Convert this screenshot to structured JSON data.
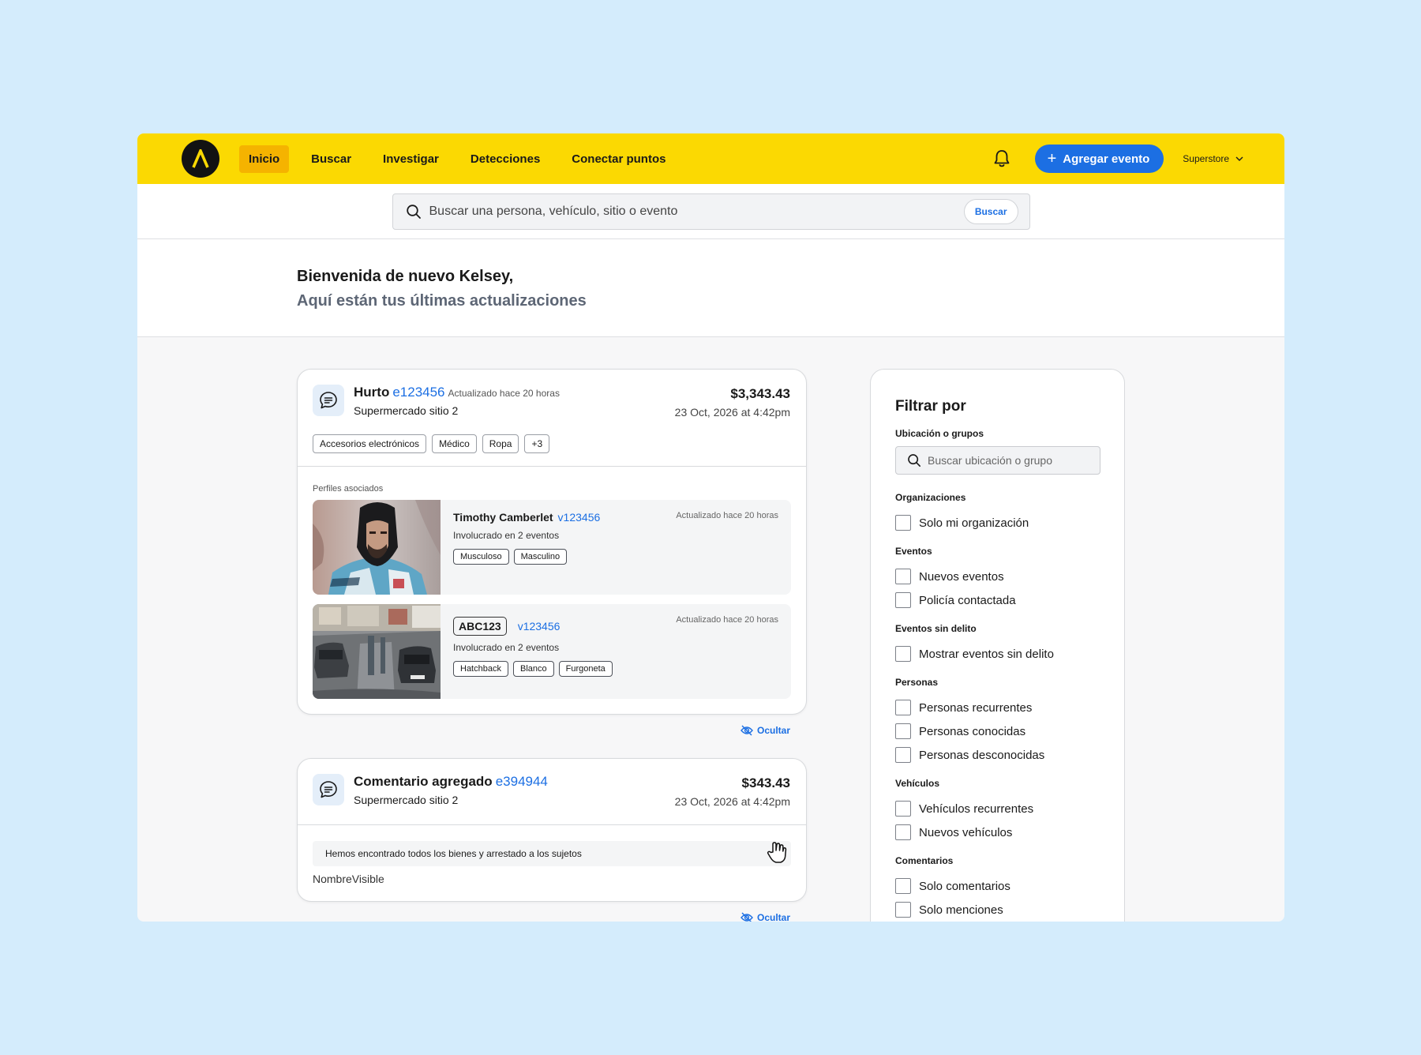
{
  "nav": {
    "items": [
      {
        "label": "Inicio",
        "active": true
      },
      {
        "label": "Buscar",
        "active": false
      },
      {
        "label": "Investigar",
        "active": false
      },
      {
        "label": "Detecciones",
        "active": false
      },
      {
        "label": "Conectar puntos",
        "active": false
      }
    ],
    "add_event_label": "Agregar evento",
    "store_label": "Superstore",
    "icons": {
      "logo": "caret-logo-icon",
      "bell": "bell-icon",
      "add": "plus-icon",
      "store": "chevron-down-icon"
    }
  },
  "search": {
    "placeholder": "Buscar una persona, vehículo, sitio o evento",
    "button_label": "Buscar"
  },
  "welcome": {
    "title": "Bienvenida de nuevo Kelsey,",
    "subtitle": "Aquí están tus últimas actualizaciones"
  },
  "events": [
    {
      "title": "Hurto",
      "id": "e123456",
      "updated": "Actualizado hace 20 horas",
      "site": "Supermercado sitio 2",
      "amount": "$3,343.43",
      "date": "23 Oct, 2026 at 4:42pm",
      "tags": [
        "Accesorios electrónicos",
        "Médico",
        "Ropa",
        "+3"
      ],
      "profiles_label": "Perfiles asociados",
      "profiles": [
        {
          "name": "Timothy Camberlet",
          "id": "v123456",
          "involved": "Involucrado en 2 eventos",
          "updated": "Actualizado hace 20 horas",
          "tags": [
            "Musculoso",
            "Masculino"
          ]
        },
        {
          "plate": "ABC123",
          "id": "v123456",
          "involved": "Involucrado en 2 eventos",
          "updated": "Actualizado hace 20 horas",
          "tags": [
            "Hatchback",
            "Blanco",
            "Furgoneta"
          ]
        }
      ],
      "hide_label": "Ocultar"
    },
    {
      "title": "Comentario agregado",
      "id": "e394944",
      "site": "Supermercado sitio 2",
      "amount": "$343.43",
      "date": "23 Oct, 2026 at 4:42pm",
      "comment": "Hemos encontrado todos los bienes y arrestado a los sujetos",
      "author": "NombreVisible",
      "hide_label": "Ocultar"
    }
  ],
  "filter": {
    "title": "Filtrar por",
    "location_label": "Ubicación o grupos",
    "location_placeholder": "Buscar ubicación o grupo",
    "sections": [
      {
        "label": "Organizaciones",
        "options": [
          "Solo mi organización"
        ]
      },
      {
        "label": "Eventos",
        "options": [
          "Nuevos eventos",
          "Policía contactada"
        ]
      },
      {
        "label": "Eventos sin delito",
        "options": [
          "Mostrar eventos sin delito"
        ]
      },
      {
        "label": "Personas",
        "options": [
          "Personas recurrentes",
          "Personas conocidas",
          "Personas desconocidas"
        ]
      },
      {
        "label": "Vehículos",
        "options": [
          "Vehículos recurrentes",
          "Nuevos vehículos"
        ]
      },
      {
        "label": "Comentarios",
        "options": [
          "Solo comentarios",
          "Solo menciones"
        ]
      }
    ]
  },
  "colors": {
    "nav_bg": "#fbd902",
    "nav_active": "#f5b300",
    "accent": "#1c6fe3",
    "page_bg": "#d4ecfc"
  }
}
